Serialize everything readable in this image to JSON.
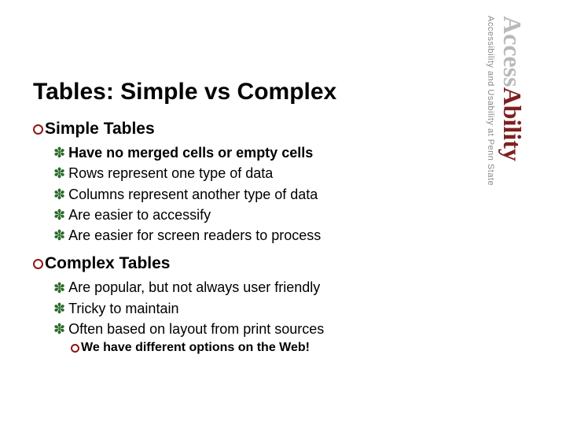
{
  "title": "Tables: Simple vs Complex",
  "sections": [
    {
      "label": "Simple Tables",
      "bullets": [
        {
          "text": "Have no merged cells or empty cells",
          "bold": true
        },
        {
          "text": "Rows represent one type of data",
          "bold": false
        },
        {
          "text": "Columns represent another type of data",
          "bold": false
        },
        {
          "text": "Are easier to accessify",
          "bold": false
        },
        {
          "text": "Are easier for screen readers to process",
          "bold": false
        }
      ]
    },
    {
      "label": "Complex Tables",
      "bullets": [
        {
          "text": "Are popular, but not always user friendly",
          "bold": false
        },
        {
          "text": "Tricky to maintain",
          "bold": false
        },
        {
          "text": "Often based on layout from print sources",
          "bold": false
        }
      ],
      "sub": "We have different options on the Web!"
    }
  ],
  "brand": {
    "part1": "Access",
    "part2": "Ability"
  },
  "tagline": "Accessibility and Usability at Penn State"
}
